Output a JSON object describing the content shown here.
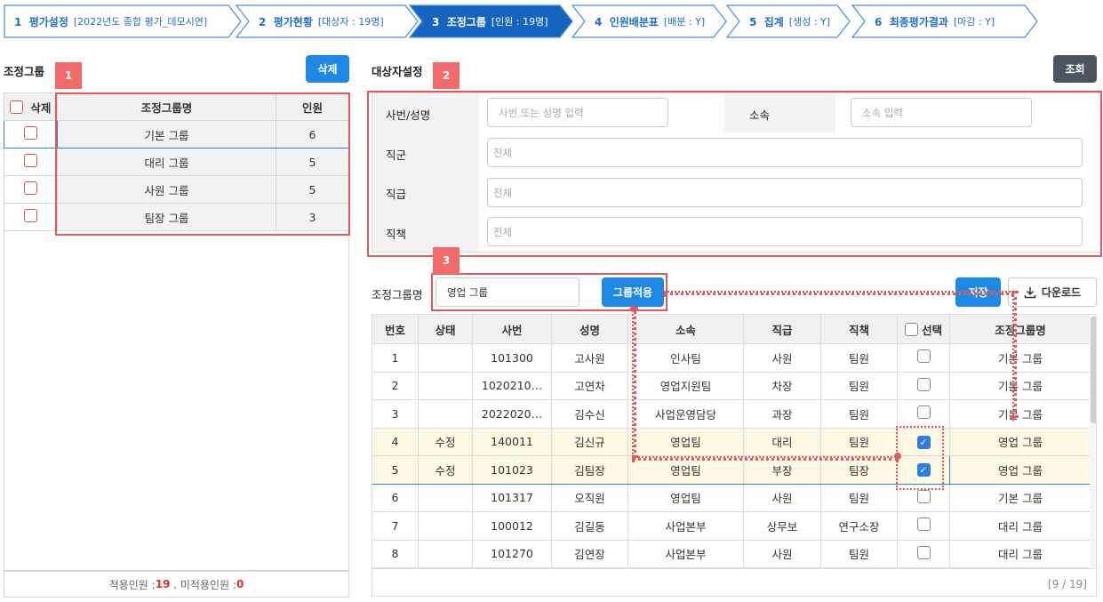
{
  "steps": [
    {
      "num": "1",
      "label": "평가설정",
      "sub": "[2022년도 종합 평가_데모시연]"
    },
    {
      "num": "2",
      "label": "평가현황",
      "sub": "[대상자 : 19명]"
    },
    {
      "num": "3",
      "label": "조정그룹",
      "sub": "[인원 : 19명]"
    },
    {
      "num": "4",
      "label": "인원배분표",
      "sub": "[배분 : Y]"
    },
    {
      "num": "5",
      "label": "집계",
      "sub": "[생성 : Y]"
    },
    {
      "num": "6",
      "label": "최종평가결과",
      "sub": "[마감 : Y]"
    }
  ],
  "colors": {
    "accent": "#1e88e5",
    "active_step": "#1565c0",
    "annotation": "#e05b5b",
    "highlight_row": "#fdf8e4"
  },
  "left": {
    "title": "조정그룹",
    "delete_button": "삭제",
    "headers": {
      "delete": "삭제",
      "group_name": "조정그룹명",
      "count": "인원"
    },
    "rows": [
      {
        "name": "기본 그룹",
        "count": "6"
      },
      {
        "name": "대리 그룹",
        "count": "5"
      },
      {
        "name": "사원 그룹",
        "count": "5"
      },
      {
        "name": "팀장 그룹",
        "count": "3"
      }
    ],
    "footer": {
      "applied_label": "적용인원 : ",
      "applied": "19",
      "sep": " , ",
      "unapplied_label": "미적용인원 : ",
      "unapplied": "0"
    }
  },
  "badges": [
    "1",
    "2",
    "3"
  ],
  "right": {
    "title": "대상자설정",
    "search_button": "조회",
    "filters": {
      "emp_label": "사번/성명",
      "emp_placeholder": "사번 또는 성명 입력",
      "dept_label": "소속",
      "dept_placeholder": "소속 입력",
      "position_label": "직군",
      "position_value": "전체",
      "grade_label": "직급",
      "grade_value": "전체",
      "duty_label": "직책",
      "duty_value": "전체"
    },
    "group_label": "조정그룹명",
    "group_value": "영업 그룹",
    "apply_button": "그룹적용",
    "save_button": "저장",
    "download_button": "다운로드",
    "headers": [
      "번호",
      "상태",
      "사번",
      "성명",
      "소속",
      "직급",
      "직책",
      "선택",
      "조정그룹명"
    ],
    "rows": [
      {
        "no": "1",
        "status": "",
        "id": "101300",
        "name": "고사원",
        "dept": "인사팀",
        "grade": "사원",
        "duty": "팀원",
        "checked": false,
        "group": "기본 그룹"
      },
      {
        "no": "2",
        "status": "",
        "id": "1020210…",
        "name": "고연차",
        "dept": "영업지원팀",
        "grade": "차장",
        "duty": "팀원",
        "checked": false,
        "group": "기본 그룹"
      },
      {
        "no": "3",
        "status": "",
        "id": "2022020…",
        "name": "김수신",
        "dept": "사업운영담당",
        "grade": "과장",
        "duty": "팀원",
        "checked": false,
        "group": "기본 그룹"
      },
      {
        "no": "4",
        "status": "수정",
        "id": "140011",
        "name": "김신규",
        "dept": "영업팀",
        "grade": "대리",
        "duty": "팀원",
        "checked": true,
        "group": "영업 그룹"
      },
      {
        "no": "5",
        "status": "수정",
        "id": "101023",
        "name": "김팀장",
        "dept": "영업팀",
        "grade": "부장",
        "duty": "팀장",
        "checked": true,
        "group": "영업 그룹"
      },
      {
        "no": "6",
        "status": "",
        "id": "101317",
        "name": "오직원",
        "dept": "영업팀",
        "grade": "사원",
        "duty": "팀원",
        "checked": false,
        "group": "기본 그룹"
      },
      {
        "no": "7",
        "status": "",
        "id": "100012",
        "name": "김길동",
        "dept": "사업본부",
        "grade": "상무보",
        "duty": "연구소장",
        "checked": false,
        "group": "대리 그룹"
      },
      {
        "no": "8",
        "status": "",
        "id": "101270",
        "name": "김연장",
        "dept": "사업본부",
        "grade": "사원",
        "duty": "팀원",
        "checked": false,
        "group": "대리 그룹"
      }
    ],
    "pagination": "[9 / 19]"
  }
}
